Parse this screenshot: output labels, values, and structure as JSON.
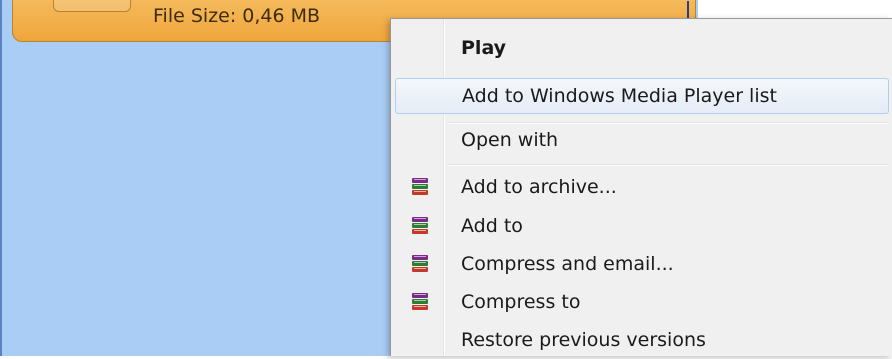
{
  "file_tile": {
    "file_size_text": "File Size: 0,46 MB"
  },
  "context_menu": {
    "items": [
      {
        "label": "Play",
        "bold": true,
        "icon": ""
      },
      {
        "label": "Add to Windows Media Player list",
        "hovered": true,
        "icon": ""
      },
      {
        "label": "Open with",
        "icon": ""
      },
      {
        "label": "Add to archive...",
        "icon": "winrar-books-icon"
      },
      {
        "label": "Add to",
        "icon": "winrar-books-icon"
      },
      {
        "label": "Compress and email...",
        "icon": "winrar-books-icon"
      },
      {
        "label": "Compress to",
        "icon": "winrar-books-icon"
      },
      {
        "label": "Restore previous versions",
        "icon": ""
      }
    ]
  },
  "colors": {
    "panel_blue": "#a9cdf5",
    "tile_orange": "#f0a53b",
    "menu_bg": "#f0f0f0",
    "hover_border": "#aecff7"
  }
}
